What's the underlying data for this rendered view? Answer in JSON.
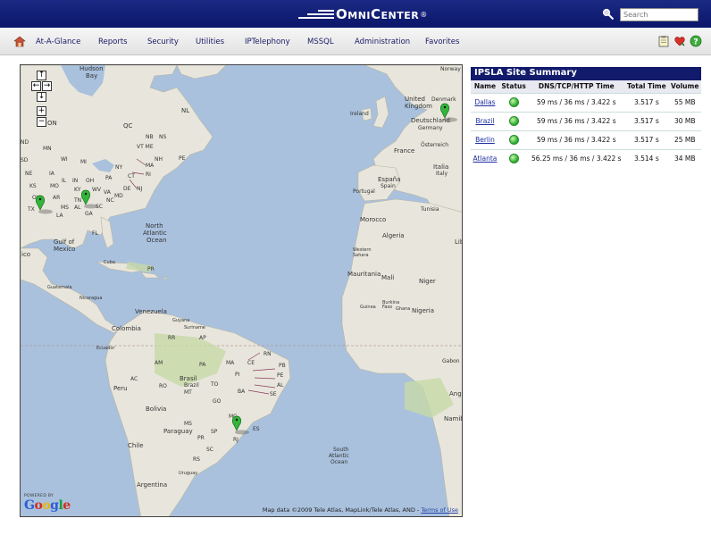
{
  "header": {
    "brand": "OmniCenter",
    "registered": "®",
    "search_placeholder": "Search"
  },
  "nav": {
    "items": [
      "At-A-Glance",
      "Reports",
      "Security",
      "Utilities",
      "IPTelephony",
      "MSSQL",
      "Administration",
      "Favorites"
    ]
  },
  "map": {
    "attribution": "Map data ©2009 Tele Atlas, MapLink/Tele Atlas, AND - ",
    "terms_link": "Terms of Use",
    "powered_by": "POWERED BY",
    "logo_text": "Google",
    "labels": [
      "Hudson Bay",
      "Norway",
      "Denmark",
      "United Kingdom",
      "Ireland",
      "Deutschland",
      "Germany",
      "France",
      "Österreich",
      "Italia",
      "Italy",
      "España",
      "Spain",
      "Portugal",
      "Tunisia",
      "Morocco",
      "Algeria",
      "Lib",
      "Western Sahara",
      "Mauritania",
      "Mali",
      "Niger",
      "Burkina Faso",
      "Ghana",
      "Guinea",
      "Nigeria",
      "Gabon",
      "Ang",
      "Namibi",
      "NL",
      "QC",
      "ON",
      "NB",
      "NS",
      "PE",
      "ME",
      "VT",
      "NH",
      "MA",
      "NY",
      "CT",
      "RI",
      "PA",
      "NJ",
      "DE",
      "MD",
      "OH",
      "IN",
      "IL",
      "WV",
      "VA",
      "KY",
      "NC",
      "TN",
      "SC",
      "GA",
      "AL",
      "MS",
      "AR",
      "LA",
      "TX",
      "OK",
      "KS",
      "MO",
      "IA",
      "NE",
      "SD",
      "ND",
      "MN",
      "WI",
      "MI",
      "FL",
      "North Atlantic Ocean",
      "Gulf of Mexico",
      "Cuba",
      "PR",
      "Guatemala",
      "Nicaragua",
      "Venezuela",
      "Guyana",
      "Suriname",
      "Colombia",
      "RR",
      "AP",
      "Ecuador",
      "AM",
      "PA",
      "MA",
      "CE",
      "RN",
      "PB",
      "PE",
      "AL",
      "SE",
      "Brasil",
      "Brazil",
      "MT",
      "TO",
      "PI",
      "AC",
      "RO",
      "BA",
      "GO",
      "Peru",
      "Bolivia",
      "MS",
      "MG",
      "ES",
      "RJ",
      "SP",
      "Paraguay",
      "PR",
      "SC",
      "RS",
      "Chile",
      "Uruguay",
      "Argentina",
      "South Atlantic Ocean",
      "ico"
    ]
  },
  "ipsla": {
    "title": "IPSLA Site Summary",
    "columns": [
      "Name",
      "Status",
      "DNS/TCP/HTTP Time",
      "Total Time",
      "Volume"
    ],
    "rows": [
      {
        "name": "Dallas",
        "status": "up",
        "times": "59 ms / 36 ms / 3.422 s",
        "total": "3.517 s",
        "volume": "55 MB"
      },
      {
        "name": "Brazil",
        "status": "up",
        "times": "59 ms / 36 ms / 3.422 s",
        "total": "3.517 s",
        "volume": "30 MB"
      },
      {
        "name": "Berlin",
        "status": "up",
        "times": "59 ms / 36 ms / 3.422 s",
        "total": "3.517 s",
        "volume": "25 MB"
      },
      {
        "name": "Atlanta",
        "status": "up",
        "times": "56.25 ms / 36 ms / 3.422 s",
        "total": "3.514 s",
        "volume": "34 MB"
      }
    ]
  },
  "icons": {
    "home": "home-icon",
    "search": "search-icon",
    "clipboard": "clipboard-icon",
    "heart": "heart-icon",
    "help": "help-icon"
  },
  "colors": {
    "header_bg": "#0b1669",
    "water": "#a9c1dd",
    "land": "#e8e6dc",
    "status_ok": "#33b53a",
    "table_header": "#111a6b"
  }
}
